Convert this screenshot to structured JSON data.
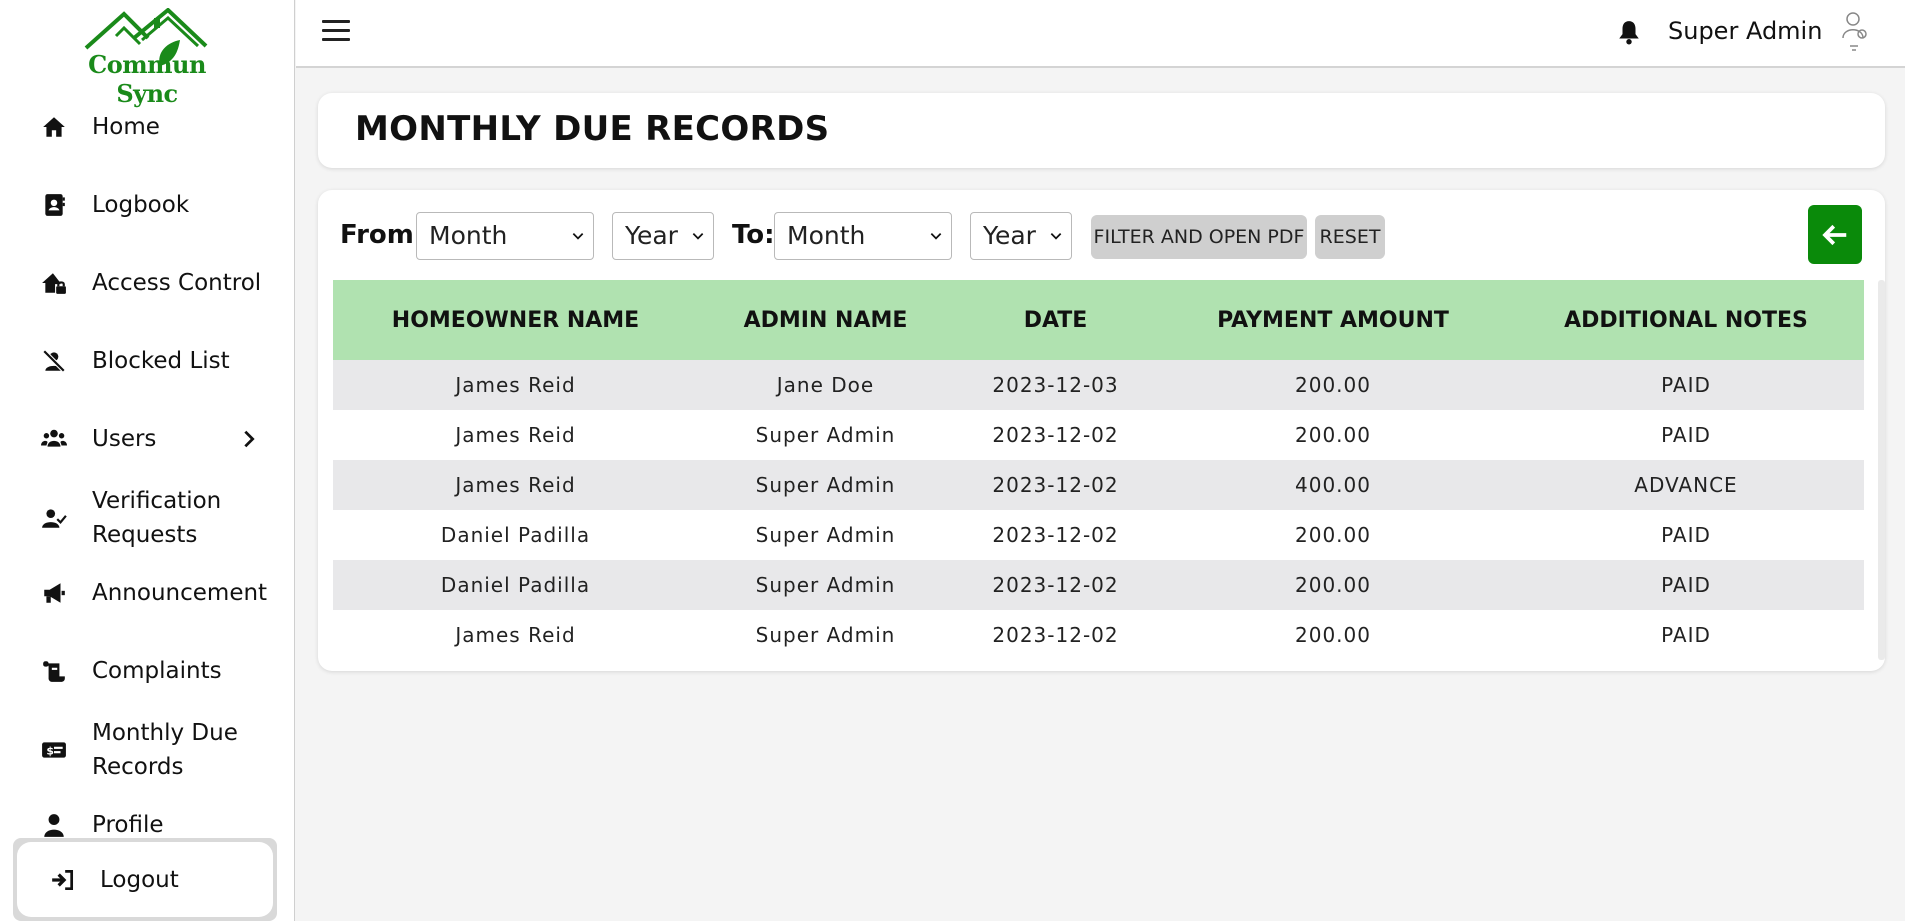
{
  "brand": {
    "name": "Commun Sync",
    "color": "#1a8a1a"
  },
  "sidebar": {
    "items": [
      {
        "label": "Home",
        "icon": "home-icon"
      },
      {
        "label": "Logbook",
        "icon": "logbook-icon"
      },
      {
        "label": "Access Control",
        "icon": "house-lock-icon"
      },
      {
        "label": "Blocked List",
        "icon": "user-slash-icon"
      },
      {
        "label": "Users",
        "icon": "users-icon",
        "has_submenu": true
      },
      {
        "label": "Verification Requests",
        "icon": "user-check-icon"
      },
      {
        "label": "Announcement",
        "icon": "megaphone-icon"
      },
      {
        "label": "Complaints",
        "icon": "scroll-icon"
      },
      {
        "label": "Monthly Due Records",
        "icon": "money-check-icon",
        "active": true
      },
      {
        "label": "Profile",
        "icon": "user-icon"
      }
    ],
    "logout_label": "Logout"
  },
  "header": {
    "user_name": "Super Admin"
  },
  "page": {
    "title": "MONTHLY DUE RECORDS"
  },
  "filters": {
    "from_label": "From:",
    "to_label": "To:",
    "from_month": "Month",
    "from_year": "Year",
    "to_month": "Month",
    "to_year": "Year",
    "filter_button": "FILTER AND OPEN PDF",
    "reset_button": "RESET"
  },
  "table": {
    "headers": [
      "HOMEOWNER NAME",
      "ADMIN NAME",
      "DATE",
      "PAYMENT AMOUNT",
      "ADDITIONAL NOTES"
    ],
    "rows": [
      [
        "James Reid",
        "Jane Doe",
        "2023-12-03",
        "200.00",
        "PAID"
      ],
      [
        "James Reid",
        "Super Admin",
        "2023-12-02",
        "200.00",
        "PAID"
      ],
      [
        "James Reid",
        "Super Admin",
        "2023-12-02",
        "400.00",
        "ADVANCE"
      ],
      [
        "Daniel Padilla",
        "Super Admin",
        "2023-12-02",
        "200.00",
        "PAID"
      ],
      [
        "Daniel Padilla",
        "Super Admin",
        "2023-12-02",
        "200.00",
        "PAID"
      ],
      [
        "James Reid",
        "Super Admin",
        "2023-12-02",
        "200.00",
        "PAID"
      ]
    ]
  },
  "colors": {
    "accent_green": "#0a8a0a",
    "table_header_bg": "#b0e2b0",
    "row_stripe": "#e8e8ea"
  }
}
